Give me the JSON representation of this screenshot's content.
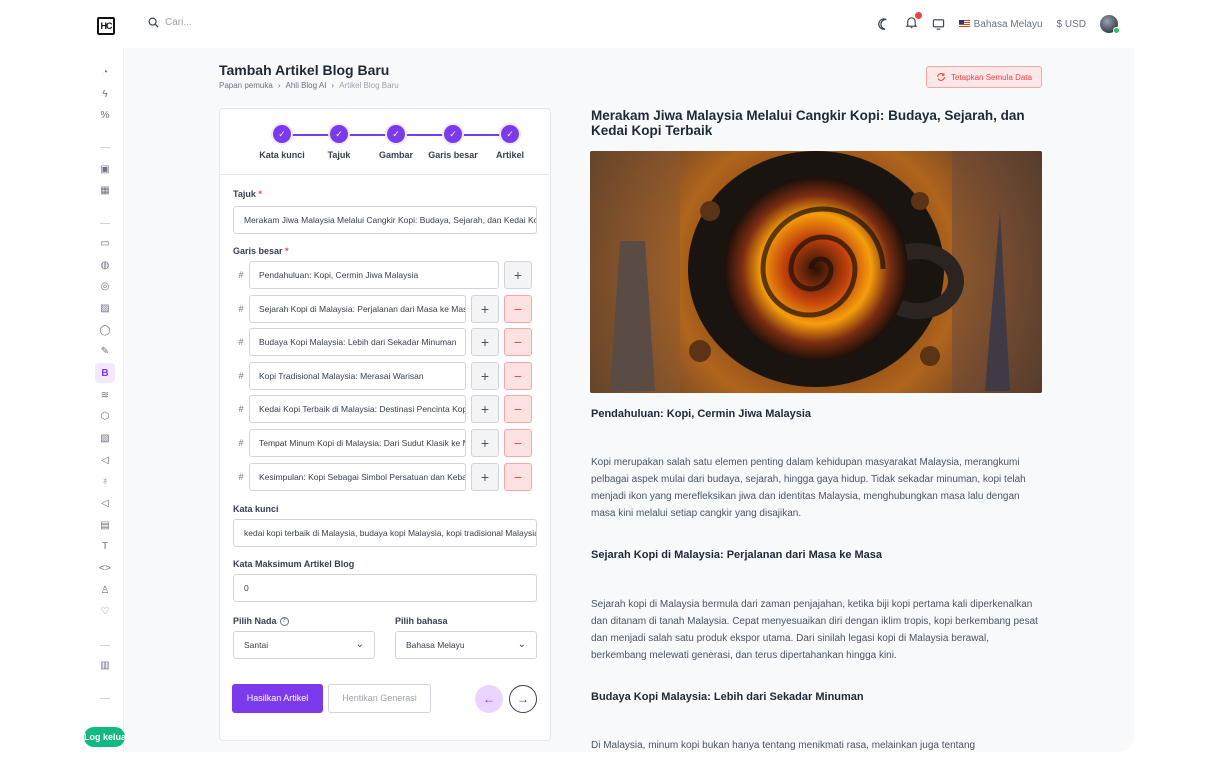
{
  "topbar": {
    "logo_text": "HC",
    "search_placeholder": "Cari...",
    "language": "Bahasa Melayu",
    "currency": "$ USD",
    "icons": [
      "moon-icon",
      "bell-icon",
      "monitor-icon",
      "flag-icon",
      "avatar"
    ]
  },
  "sidebar": {
    "logout_label": "Log keluar"
  },
  "page": {
    "title": "Tambah Artikel Blog Baru",
    "breadcrumb": [
      "Papan pemuka",
      "Ahli Blog AI",
      "Artikel Blog Baru"
    ],
    "reset_label": "Tetapkan Semula Data"
  },
  "steps": [
    "Kata kunci",
    "Tajuk",
    "Gambar",
    "Garis besar",
    "Artikel"
  ],
  "form": {
    "title_label": "Tajuk",
    "title_value": "Merakam Jiwa Malaysia Melalui Cangkir Kopi: Budaya, Sejarah, dan Kedai Kopi Terbaik",
    "outline_label": "Garis besar",
    "outline": [
      "Pendahuluan: Kopi, Cermin Jiwa Malaysia",
      "Sejarah Kopi di Malaysia: Perjalanan dari Masa ke Masa",
      "Budaya Kopi Malaysia: Lebih dari Sekadar Minuman",
      "Kopi Tradisional Malaysia: Merasai Warisan",
      "Kedai Kopi Terbaik di Malaysia: Destinasi Pencinta Kopi",
      "Tempat Minum Kopi di Malaysia: Dari Sudut Klasik ke Moden",
      "Kesimpulan: Kopi Sebagai Simbol Persatuan dan Kebanggaan"
    ],
    "keywords_label": "Kata kunci",
    "keywords_value": "kedai kopi terbaik di Malaysia, budaya kopi Malaysia, kopi tradisional Malaysia",
    "max_words_label": "Kata Maksimum Artikel Blog",
    "max_words_value": "0",
    "tone_label": "Pilih Nada",
    "tone_value": "Santai",
    "lang_label": "Pilih bahasa",
    "lang_value": "Bahasa Melayu",
    "generate_label": "Hasilkan Artikel",
    "stop_label": "Hentikan Generasi"
  },
  "article": {
    "title": "Merakam Jiwa Malaysia Melalui Cangkir Kopi: Budaya, Sejarah, dan Kedai Kopi Terbaik",
    "sections": [
      {
        "heading": "Pendahuluan: Kopi, Cermin Jiwa Malaysia",
        "body": "Kopi merupakan salah satu elemen penting dalam kehidupan masyarakat Malaysia, merangkumi pelbagai aspek mulai dari budaya, sejarah, hingga gaya hidup. Tidak sekadar minuman, kopi telah menjadi ikon yang merefleksikan jiwa dan identitas Malaysia, menghubungkan masa lalu dengan masa kini melalui setiap cangkir yang disajikan."
      },
      {
        "heading": "Sejarah Kopi di Malaysia: Perjalanan dari Masa ke Masa",
        "body": "Sejarah kopi di Malaysia bermula dari zaman penjajahan, ketika biji kopi pertama kali diperkenalkan dan ditanam di tanah Malaysia. Cepat menyesuaikan diri dengan iklim tropis, kopi berkembang pesat dan menjadi salah satu produk ekspor utama. Dari sinilah legasi kopi di Malaysia berawal, berkembang melewati generasi, dan terus dipertahankan hingga kini."
      },
      {
        "heading": "Budaya Kopi Malaysia: Lebih dari Sekadar Minuman",
        "body": "Di Malaysia, minum kopi bukan hanya tentang menikmati rasa, melainkan juga tentang"
      }
    ]
  }
}
